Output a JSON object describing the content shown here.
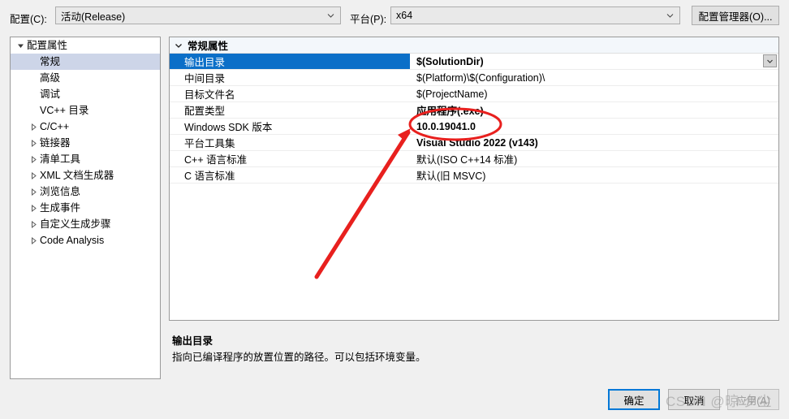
{
  "colors": {
    "accent": "#0078d7",
    "grid_selection": "#0b6fc8",
    "tree_selection": "#cdd5e8",
    "annotation_red": "#e8201e",
    "dialog_bg": "#f0f0f0"
  },
  "topbar": {
    "config_label": "配置(C):",
    "config_value": "活动(Release)",
    "platform_label": "平台(P):",
    "platform_value": "x64",
    "config_manager_button": "配置管理器(O)..."
  },
  "tree": {
    "items": [
      {
        "label": "配置属性",
        "indent": 0,
        "expander": "triangle-down",
        "selected": false
      },
      {
        "label": "常规",
        "indent": 1,
        "expander": "none",
        "selected": true
      },
      {
        "label": "高级",
        "indent": 1,
        "expander": "none",
        "selected": false
      },
      {
        "label": "调试",
        "indent": 1,
        "expander": "none",
        "selected": false
      },
      {
        "label": "VC++ 目录",
        "indent": 1,
        "expander": "none",
        "selected": false
      },
      {
        "label": "C/C++",
        "indent": 1,
        "expander": "triangle-right",
        "selected": false
      },
      {
        "label": "链接器",
        "indent": 1,
        "expander": "triangle-right",
        "selected": false
      },
      {
        "label": "清单工具",
        "indent": 1,
        "expander": "triangle-right",
        "selected": false
      },
      {
        "label": "XML 文档生成器",
        "indent": 1,
        "expander": "triangle-right",
        "selected": false
      },
      {
        "label": "浏览信息",
        "indent": 1,
        "expander": "triangle-right",
        "selected": false
      },
      {
        "label": "生成事件",
        "indent": 1,
        "expander": "triangle-right",
        "selected": false
      },
      {
        "label": "自定义生成步骤",
        "indent": 1,
        "expander": "triangle-right",
        "selected": false
      },
      {
        "label": "Code Analysis",
        "indent": 1,
        "expander": "triangle-right",
        "selected": false
      }
    ]
  },
  "grid": {
    "section_header": "常规属性",
    "section_expander": "chevron-down-icon",
    "rows": [
      {
        "name": "输出目录",
        "value": "$(SolutionDir)",
        "selected": true,
        "bold": true,
        "has_dropdown": true
      },
      {
        "name": "中间目录",
        "value": "$(Platform)\\$(Configuration)\\",
        "selected": false,
        "bold": false,
        "has_dropdown": false
      },
      {
        "name": "目标文件名",
        "value": "$(ProjectName)",
        "selected": false,
        "bold": false,
        "has_dropdown": false
      },
      {
        "name": "配置类型",
        "value": "应用程序(.exe)",
        "selected": false,
        "bold": true,
        "has_dropdown": false
      },
      {
        "name": "Windows SDK 版本",
        "value": "10.0.19041.0",
        "selected": false,
        "bold": true,
        "has_dropdown": false
      },
      {
        "name": "平台工具集",
        "value": "Visual Studio 2022 (v143)",
        "selected": false,
        "bold": true,
        "has_dropdown": false
      },
      {
        "name": "C++ 语言标准",
        "value": "默认(ISO C++14 标准)",
        "selected": false,
        "bold": false,
        "has_dropdown": false
      },
      {
        "name": "C 语言标准",
        "value": "默认(旧 MSVC)",
        "selected": false,
        "bold": false,
        "has_dropdown": false
      }
    ]
  },
  "description": {
    "title": "输出目录",
    "text": "指向已编译程序的放置位置的路径。可以包括环境变量。"
  },
  "footer": {
    "ok_button": "确定",
    "cancel_button": "取消",
    "apply_button": "应用(A)"
  },
  "annotations": {
    "highlight_target": "10.0.19041.0",
    "watermark": "CSDN @晾 夕尘"
  }
}
